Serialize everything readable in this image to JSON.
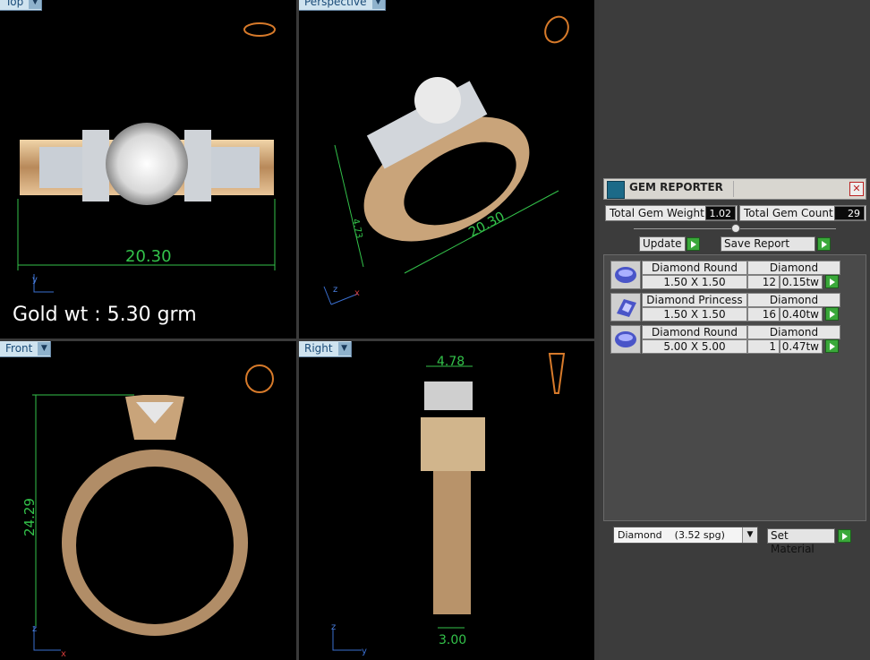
{
  "viewports": {
    "top": {
      "label": "Top",
      "dimension": "20.30"
    },
    "perspective": {
      "label": "Perspective",
      "dimension_long": "20.30",
      "dimension_short": "4.73"
    },
    "front": {
      "label": "Front",
      "dimension": "24.29"
    },
    "right": {
      "label": "Right",
      "dimension_top": "4.78",
      "dimension_bottom": "3.00"
    }
  },
  "gold_weight": "Gold wt : 5.30 grm",
  "axes": {
    "x": "x",
    "y": "y",
    "z": "z"
  },
  "gem_reporter": {
    "title": "GEM REPORTER",
    "total_gem_weight_label": "Total Gem Weight",
    "total_gem_weight": "1.02",
    "total_gem_count_label": "Total Gem Count",
    "total_gem_count": "29",
    "update_label": "Update",
    "save_report_label": "Save Report",
    "gems": [
      {
        "name": "Diamond Round",
        "material": "Diamond",
        "size": "1.50 X 1.50",
        "count": "12",
        "weight": "0.15tw"
      },
      {
        "name": "Diamond Princess",
        "material": "Diamond",
        "size": "1.50 X 1.50",
        "count": "16",
        "weight": "0.40tw"
      },
      {
        "name": "Diamond Round",
        "material": "Diamond",
        "size": "5.00 X 5.00",
        "count": "1",
        "weight": "0.47tw"
      }
    ],
    "material_select": "Diamond    (3.52 spg)",
    "set_material_label": "Set Material"
  },
  "colors": {
    "dimension": "#33c24a",
    "gold": "#c9a47a",
    "viewport_bg": "#000000",
    "tab_bg": "#cfe3ef"
  }
}
